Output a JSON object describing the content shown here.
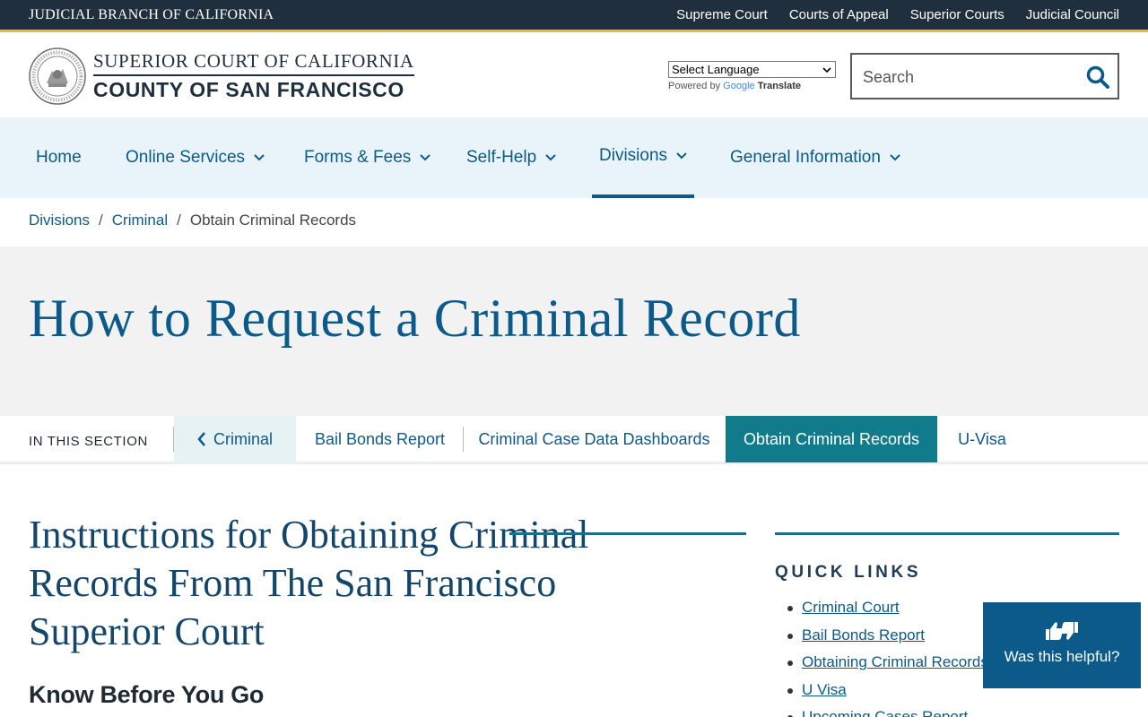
{
  "utility_bar": {
    "brand": "JUDICIAL BRANCH OF CALIFORNIA",
    "links": [
      "Supreme Court",
      "Courts of Appeal",
      "Superior Courts",
      "Judicial Council"
    ]
  },
  "header": {
    "court_line1": "SUPERIOR COURT OF CALIFORNIA",
    "court_line2": "COUNTY OF SAN FRANCISCO",
    "language_select": "Select Language",
    "powered_by": "Powered by",
    "google": "Google",
    "translate": "Translate",
    "search_placeholder": "Search",
    "search_icon": "search-icon"
  },
  "nav": {
    "items": [
      {
        "label": "Home",
        "has_dropdown": false
      },
      {
        "label": "Online Services",
        "has_dropdown": true
      },
      {
        "label": "Forms & Fees",
        "has_dropdown": true
      },
      {
        "label": "Self-Help",
        "has_dropdown": true
      },
      {
        "label": "Divisions",
        "has_dropdown": true,
        "active": true
      },
      {
        "label": "General Information",
        "has_dropdown": true
      }
    ]
  },
  "breadcrumb": {
    "items": [
      "Divisions",
      "Criminal"
    ],
    "separator": "/",
    "current": "Obtain Criminal Records"
  },
  "hero": {
    "title": "How to Request a Criminal Record"
  },
  "section_nav": {
    "label": "IN THIS SECTION",
    "back": "Criminal",
    "tabs": [
      "Bail Bonds Report",
      "Criminal Case Data Dashboards",
      "Obtain Criminal Records",
      "U-Visa"
    ],
    "active": "Obtain Criminal Records"
  },
  "content": {
    "title": "Instructions for Obtaining Criminal Records From The San Francisco Superior Court",
    "subhead": "Know Before You Go"
  },
  "quick_links": {
    "title": "QUICK LINKS",
    "items": [
      "Criminal Court",
      "Bail Bonds Report",
      "Obtaining Criminal Records",
      "U Visa",
      "Upcoming Cases Report"
    ]
  },
  "helpful": {
    "label": "Was this helpful?",
    "icon": "thumbs-up-down-icon"
  },
  "colors": {
    "utility_bg": "#1f2f3d",
    "accent_gold": "#f2b634",
    "link_blue": "#0b5a8a",
    "teal_active": "#117a8b",
    "nav_bg": "#e9f3fa",
    "hero_bg": "#f2f2f2"
  }
}
